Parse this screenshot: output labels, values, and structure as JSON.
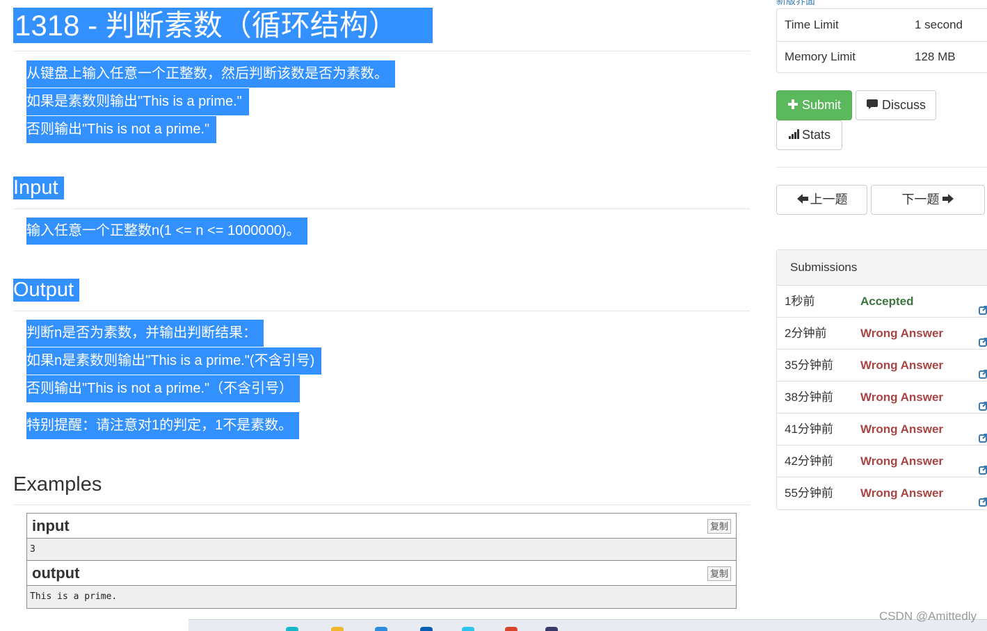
{
  "problem": {
    "title": "1318 - 判断素数（循环结构）",
    "description": [
      "从键盘上输入任意一个正整数，然后判断该数是否为素数。",
      "如果是素数则输出\"This is a prime.\"",
      "否则输出\"This is not a prime.\""
    ],
    "input_heading": "Input",
    "input_text": "输入任意一个正整数n(1 <= n <= 1000000)。",
    "output_heading": "Output",
    "output_lines": [
      "判断n是否为素数，并输出判断结果：",
      "如果n是素数则输出\"This is a prime.\"(不含引号)",
      "否则输出\"This is not a prime.\"（不含引号）",
      "特别提醒：请注意对1的判定，1不是素数。"
    ],
    "examples_heading": "Examples",
    "example": {
      "input_label": "input",
      "input_value": "3",
      "output_label": "output",
      "output_value": "This is a prime.",
      "copy_label": "复制"
    },
    "highlight_color": "#3390ff"
  },
  "sidebar": {
    "new_ui_link": "新版界面",
    "limits": [
      {
        "label": "Time Limit",
        "value": "1 second"
      },
      {
        "label": "Memory Limit",
        "value": "128 MB"
      }
    ],
    "buttons": {
      "submit": "Submit",
      "discuss": "Discuss",
      "stats": "Stats",
      "prev": "上一题",
      "next": "下一题"
    },
    "submissions_heading": "Submissions",
    "submissions": [
      {
        "time": "1秒前",
        "result": "Accepted",
        "status": "ok"
      },
      {
        "time": "2分钟前",
        "result": "Wrong Answer",
        "status": "wa"
      },
      {
        "time": "35分钟前",
        "result": "Wrong Answer",
        "status": "wa"
      },
      {
        "time": "38分钟前",
        "result": "Wrong Answer",
        "status": "wa"
      },
      {
        "time": "41分钟前",
        "result": "Wrong Answer",
        "status": "wa"
      },
      {
        "time": "42分钟前",
        "result": "Wrong Answer",
        "status": "wa"
      },
      {
        "time": "55分钟前",
        "result": "Wrong Answer",
        "status": "wa"
      }
    ],
    "colors": {
      "submit_green": "#5cb85c",
      "accepted": "#3c763d",
      "wrong": "#a94442",
      "link": "#337ab7"
    }
  },
  "watermark": "CSDN @Amittedly"
}
